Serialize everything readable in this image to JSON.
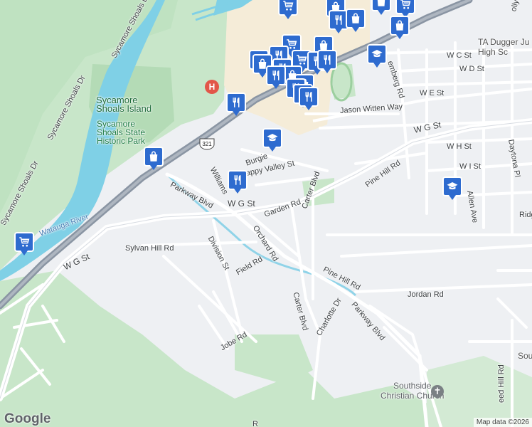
{
  "map": {
    "colors": {
      "land": "#eef0f3",
      "park": "#c8e6c9",
      "river": "#7fd0e6",
      "highway": "#8a95a3",
      "commercial": "#f5ecd8",
      "pin": "#2e6bcf",
      "hospital": "#e25649"
    },
    "labels": {
      "sycamore_shoals_island": "Sycamore\nShoals Island",
      "state_park": "Sycamore\nShoals State\nHistoric Park",
      "watauga_river": "Watauga River",
      "sycamore_shoals_dr": "Sycamore Shoals Dr",
      "ta_dugger": "TA Dugger Ju\nHigh Sc",
      "southside_church": "Southside\nChristian Church",
      "south_edge": "South",
      "dolly_ln": "olly Ln"
    },
    "roads": {
      "w_g_st_east": "W G St",
      "w_g_st_mid": "W G St",
      "w_g_st_west": "W G St",
      "w_c_st": "W C St",
      "w_d_st": "W D St",
      "w_e_st": "W E St",
      "w_h_st": "W H St",
      "w_i_st": "W I St",
      "jason_witten_way": "Jason Witten Way",
      "burgie": "Burgie",
      "happy_valley_st": "appy Valley St",
      "williams": "Williams",
      "parkway_blvd": "Parkway Blvd",
      "parkway_blvd_south": "Parkway Blvd",
      "division_st": "Division St",
      "orchard_rd": "Orchard Rd",
      "garden_rd": "Garden Rd",
      "carter_blvd": "Carter Blvd",
      "carter_blvd_south": "Carter Blvd",
      "pine_hill_rd": "Pine Hill Rd",
      "pine_hill_rd_south": "Pine Hill Rd",
      "sylvan_hill_rd": "Sylvan Hill Rd",
      "field_rd": "Field Rd",
      "charlotte_dr": "Charlotte Dr",
      "jordan_rd": "Jordan Rd",
      "jobe_rd": "Jobe Rd",
      "allen_ave": "Allen Ave",
      "daytona_pl": "Daytona Pl",
      "ridge": "Ridg",
      "hill_rd": "eed Hill Rd",
      "elemberg_rd": "emberg Rd",
      "route_321": "321",
      "r_south": "R"
    },
    "pins": [
      {
        "type": "shopping-cart",
        "label": "shopping-cart"
      },
      {
        "type": "restaurant",
        "label": "restaurant"
      },
      {
        "type": "shopping-bag",
        "label": "shopping-bag"
      },
      {
        "type": "school",
        "label": "school"
      }
    ],
    "branding": {
      "logo": "Google",
      "attribution": "Map data ©2026"
    }
  }
}
